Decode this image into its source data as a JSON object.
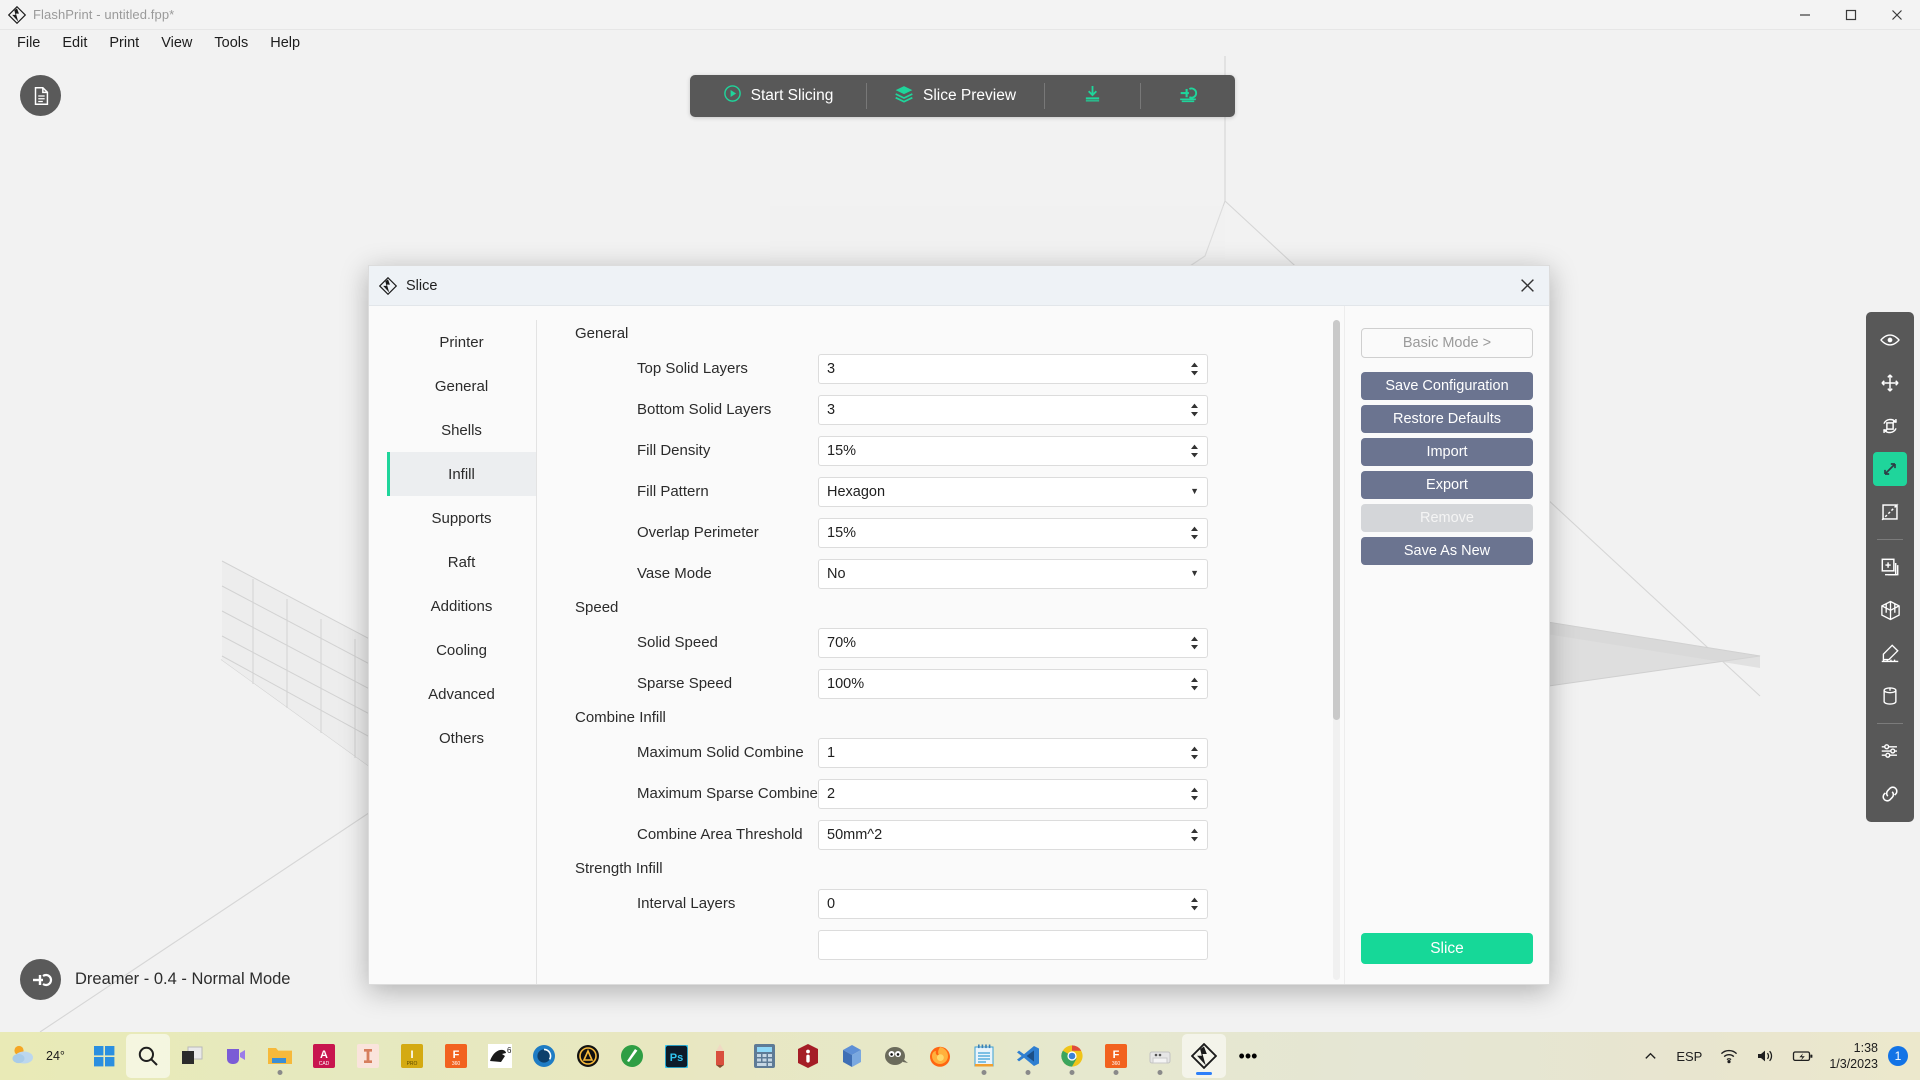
{
  "window": {
    "title": "FlashPrint - untitled.fpp*",
    "logo_icon": "flashprint-diamond-logo",
    "controls": {
      "minimize": "minimize-icon",
      "maximize": "maximize-icon",
      "close": "close-icon"
    }
  },
  "menubar": {
    "items": [
      {
        "label": "File"
      },
      {
        "label": "Edit"
      },
      {
        "label": "Print"
      },
      {
        "label": "View"
      },
      {
        "label": "Tools"
      },
      {
        "label": "Help"
      }
    ]
  },
  "toolbar": {
    "start_slicing": "Start Slicing",
    "slice_preview": "Slice Preview",
    "download_icon": "download-icon",
    "export_icon": "export-to-printer-icon"
  },
  "viewport": {
    "doc_icon": "document-icon",
    "status_icon": "extruder-icon",
    "status_text": "Dreamer - 0.4 - Normal Mode"
  },
  "right_tools": {
    "items": [
      {
        "name": "view-icon",
        "active": false
      },
      {
        "name": "move-icon",
        "active": false
      },
      {
        "name": "rotate-icon",
        "active": false
      },
      {
        "name": "scale-icon",
        "active": true
      },
      {
        "name": "cut-icon",
        "active": false
      },
      {
        "name": "extruder-add-icon",
        "active": false
      },
      {
        "name": "supports-icon",
        "active": false
      },
      {
        "name": "support-eraser-icon",
        "active": false
      },
      {
        "name": "filament-spool-icon",
        "active": false
      },
      {
        "name": "settings-sliders-icon",
        "active": false
      },
      {
        "name": "link-icon",
        "active": false
      }
    ]
  },
  "dialog": {
    "title": "Slice",
    "title_icon": "flashprint-diamond-logo",
    "close_icon": "close-icon",
    "nav": [
      {
        "label": "Printer",
        "active": false
      },
      {
        "label": "General",
        "active": false
      },
      {
        "label": "Shells",
        "active": false
      },
      {
        "label": "Infill",
        "active": true
      },
      {
        "label": "Supports",
        "active": false
      },
      {
        "label": "Raft",
        "active": false
      },
      {
        "label": "Additions",
        "active": false
      },
      {
        "label": "Cooling",
        "active": false
      },
      {
        "label": "Advanced",
        "active": false
      },
      {
        "label": "Others",
        "active": false
      }
    ],
    "groups": [
      {
        "title": "General",
        "rows": [
          {
            "label": "Top Solid Layers",
            "value": "3",
            "type": "spinner"
          },
          {
            "label": "Bottom Solid Layers",
            "value": "3",
            "type": "spinner"
          },
          {
            "label": "Fill Density",
            "value": "15%",
            "type": "spinner"
          },
          {
            "label": "Fill Pattern",
            "value": "Hexagon",
            "type": "select"
          },
          {
            "label": "Overlap Perimeter",
            "value": "15%",
            "type": "spinner"
          },
          {
            "label": "Vase Mode",
            "value": "No",
            "type": "select"
          }
        ]
      },
      {
        "title": "Speed",
        "rows": [
          {
            "label": "Solid Speed",
            "value": "70%",
            "type": "spinner"
          },
          {
            "label": "Sparse Speed",
            "value": "100%",
            "type": "spinner"
          }
        ]
      },
      {
        "title": "Combine Infill",
        "rows": [
          {
            "label": "Maximum Solid Combine",
            "value": "1",
            "type": "spinner"
          },
          {
            "label": "Maximum Sparse Combine",
            "value": "2",
            "type": "spinner"
          },
          {
            "label": "Combine Area Threshold",
            "value": "50mm^2",
            "type": "spinner"
          }
        ]
      },
      {
        "title": "Strength Infill",
        "rows": [
          {
            "label": "Interval Layers",
            "value": "0",
            "type": "spinner"
          }
        ]
      }
    ],
    "actions": {
      "basic_mode": "Basic Mode >",
      "save_configuration": "Save Configuration",
      "restore_defaults": "Restore Defaults",
      "import": "Import",
      "export": "Export",
      "remove": "Remove",
      "save_as_new": "Save As New",
      "slice": "Slice"
    }
  },
  "taskbar": {
    "weather": {
      "temp": "24°",
      "icon": "partly-cloudy-icon"
    },
    "apps": [
      {
        "name": "start-button-icon",
        "selected": false,
        "running": false
      },
      {
        "name": "search-icon",
        "selected": true,
        "running": false
      },
      {
        "name": "task-view-icon",
        "selected": false,
        "running": false
      },
      {
        "name": "microsoft-teams-icon",
        "selected": false,
        "running": false
      },
      {
        "name": "file-explorer-icon",
        "selected": false,
        "running": true
      },
      {
        "name": "autocad-icon",
        "selected": false,
        "running": false
      },
      {
        "name": "inventor-pro-icon",
        "selected": false,
        "running": false
      },
      {
        "name": "inventor-icon",
        "selected": false,
        "running": false
      },
      {
        "name": "fusion360-icon",
        "selected": false,
        "running": false
      },
      {
        "name": "rhino6-icon",
        "selected": false,
        "running": false
      },
      {
        "name": "keyshot-icon",
        "selected": false,
        "running": false
      },
      {
        "name": "autodesk-icon",
        "selected": false,
        "running": false
      },
      {
        "name": "sketchup-icon",
        "selected": false,
        "running": false
      },
      {
        "name": "photoshop-icon",
        "selected": false,
        "running": false
      },
      {
        "name": "pencil-icon",
        "selected": false,
        "running": false
      },
      {
        "name": "calculator-icon",
        "selected": false,
        "running": false
      },
      {
        "name": "ultimaker-cura-icon",
        "selected": false,
        "running": false
      },
      {
        "name": "prusa-slicer-icon",
        "selected": false,
        "running": false
      },
      {
        "name": "gimp-icon",
        "selected": false,
        "running": false
      },
      {
        "name": "firefox-icon",
        "selected": false,
        "running": true
      },
      {
        "name": "notepad-icon",
        "selected": false,
        "running": true
      },
      {
        "name": "vscode-icon",
        "selected": false,
        "running": true
      },
      {
        "name": "chrome-icon",
        "selected": false,
        "running": true
      },
      {
        "name": "fusion360-second-icon",
        "selected": false,
        "running": true
      },
      {
        "name": "printer-utility-icon",
        "selected": false,
        "running": true
      },
      {
        "name": "flashprint-icon",
        "selected": true,
        "running": true
      }
    ],
    "overflow": "•••",
    "tray": {
      "chevron_icon": "chevron-up-icon",
      "language": "ESP",
      "wifi_icon": "wifi-icon",
      "volume_icon": "volume-icon",
      "battery_icon": "battery-icon",
      "time": "1:38",
      "date": "1/3/2023",
      "notification_count": "1"
    }
  }
}
